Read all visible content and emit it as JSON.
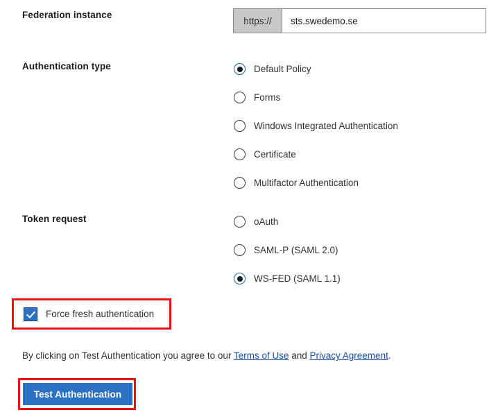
{
  "federation": {
    "label": "Federation instance",
    "prefix": "https://",
    "value": "sts.swedemo.se",
    "placeholder": ""
  },
  "auth_type": {
    "label": "Authentication type",
    "options": [
      {
        "label": "Default Policy",
        "checked": true
      },
      {
        "label": "Forms",
        "checked": false
      },
      {
        "label": "Windows Integrated Authentication",
        "checked": false
      },
      {
        "label": "Certificate",
        "checked": false
      },
      {
        "label": "Multifactor Authentication",
        "checked": false
      }
    ]
  },
  "token_request": {
    "label": "Token request",
    "options": [
      {
        "label": "oAuth",
        "checked": false
      },
      {
        "label": "SAML-P (SAML 2.0)",
        "checked": false
      },
      {
        "label": "WS-FED (SAML 1.1)",
        "checked": true
      }
    ]
  },
  "force_fresh": {
    "label": "Force fresh authentication",
    "checked": true
  },
  "legal": {
    "prefix": "By clicking on Test Authentication you agree to our ",
    "terms_link": "Terms of Use",
    "middle": " and ",
    "privacy_link": "Privacy Agreement",
    "suffix": "."
  },
  "actions": {
    "test_authentication": "Test Authentication"
  },
  "colors": {
    "accent_blue": "#2b72c4",
    "radio_selected_ring": "#1466b8",
    "link_blue": "#1a4fa0",
    "highlight_red": "#ee1111",
    "prefix_gray": "#c8c8c8"
  }
}
